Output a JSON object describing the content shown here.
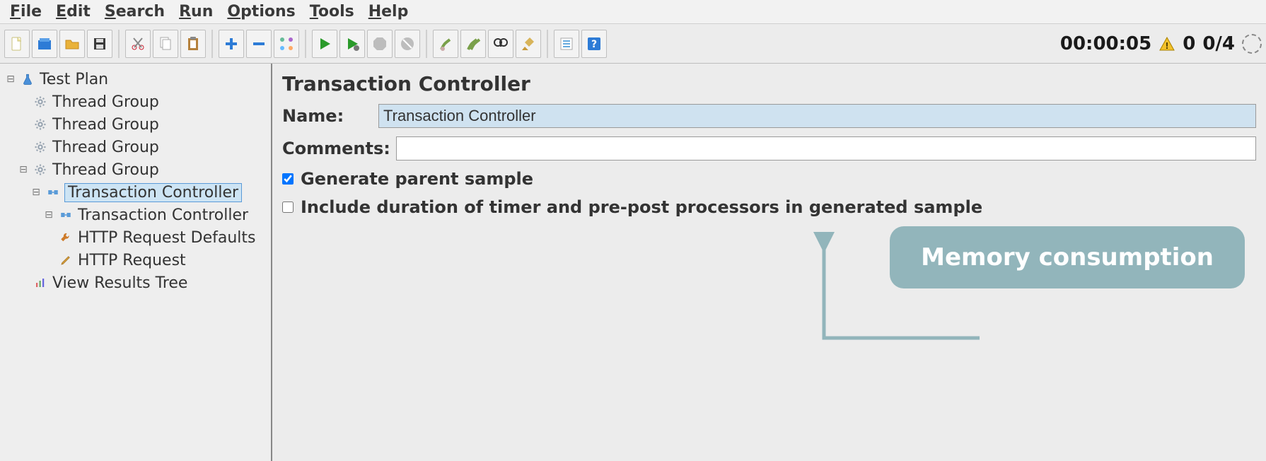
{
  "menubar": {
    "items": [
      "File",
      "Edit",
      "Search",
      "Run",
      "Options",
      "Tools",
      "Help"
    ]
  },
  "toolbar": {
    "icons": [
      "new-file",
      "templates",
      "open",
      "save",
      "cut",
      "copy",
      "paste",
      "plus",
      "minus",
      "wand",
      "start",
      "start-no-pause",
      "stop",
      "shutdown",
      "clear",
      "clear-all",
      "find",
      "broom",
      "tasks",
      "help"
    ]
  },
  "status": {
    "time": "00:00:05",
    "errors": "0",
    "threads": "0/4"
  },
  "tree": {
    "items": [
      {
        "label": "Test Plan",
        "icon": "flask",
        "indent": 0,
        "twisty": "open",
        "selected": false
      },
      {
        "label": "Thread Group",
        "icon": "gear",
        "indent": 1,
        "twisty": "none",
        "selected": false
      },
      {
        "label": "Thread Group",
        "icon": "gear",
        "indent": 1,
        "twisty": "none",
        "selected": false
      },
      {
        "label": "Thread Group",
        "icon": "gear",
        "indent": 1,
        "twisty": "none",
        "selected": false
      },
      {
        "label": "Thread Group",
        "icon": "gear",
        "indent": 1,
        "twisty": "open",
        "selected": false
      },
      {
        "label": "Transaction Controller",
        "icon": "controller",
        "indent": 2,
        "twisty": "open",
        "selected": true
      },
      {
        "label": "Transaction Controller",
        "icon": "controller",
        "indent": 3,
        "twisty": "open",
        "selected": false
      },
      {
        "label": "HTTP Request Defaults",
        "icon": "wrench",
        "indent": 3,
        "twisty": "none",
        "selected": false
      },
      {
        "label": "HTTP Request",
        "icon": "pencil",
        "indent": 3,
        "twisty": "none",
        "selected": false
      },
      {
        "label": "View Results Tree",
        "icon": "chart",
        "indent": 1,
        "twisty": "none",
        "selected": false
      }
    ]
  },
  "editor": {
    "heading": "Transaction Controller",
    "name_label": "Name:",
    "name_value": "Transaction Controller",
    "comments_label": "Comments:",
    "comments_value": "",
    "cb1_label": "Generate parent sample",
    "cb1_checked": true,
    "cb2_label": "Include duration of timer and pre-post processors in generated sample",
    "cb2_checked": false
  },
  "callout": {
    "text": "Memory consumption"
  }
}
